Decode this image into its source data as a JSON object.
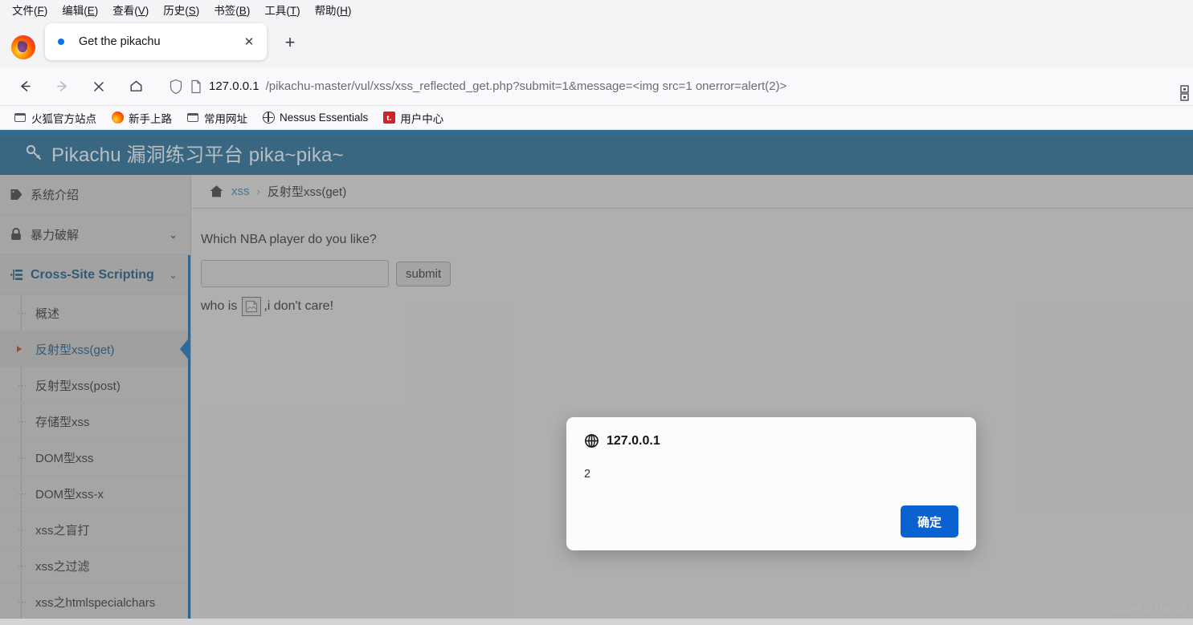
{
  "browser": {
    "menus": [
      {
        "label": "文件",
        "accel": "F"
      },
      {
        "label": "编辑",
        "accel": "E"
      },
      {
        "label": "查看",
        "accel": "V"
      },
      {
        "label": "历史",
        "accel": "S"
      },
      {
        "label": "书签",
        "accel": "B"
      },
      {
        "label": "工具",
        "accel": "T"
      },
      {
        "label": "帮助",
        "accel": "H"
      }
    ],
    "tab": {
      "title": "Get the pikachu",
      "close_label": "✕",
      "newtab_label": "+"
    },
    "nav": {
      "back": "←",
      "forward": "→",
      "stop": "✕",
      "home": "⌂"
    },
    "url": {
      "host": "127.0.0.1",
      "path": "/pikachu-master/vul/xss/xss_reflected_get.php?submit=1&message=<img src=1 onerror=alert(2)>"
    },
    "bookmarks": [
      {
        "label": "火狐官方站点",
        "icon": "folder-icon"
      },
      {
        "label": "新手上路",
        "icon": "firefox-icon"
      },
      {
        "label": "常用网址",
        "icon": "folder-icon"
      },
      {
        "label": "Nessus Essentials",
        "icon": "globe-icon"
      },
      {
        "label": "用户中心",
        "icon": "tencent-icon"
      }
    ]
  },
  "site": {
    "brand": "Pikachu 漏洞练习平台 pika~pika~",
    "sidebar": [
      {
        "label": "系统介绍",
        "icon": "tag-icon",
        "type": "link"
      },
      {
        "label": "暴力破解",
        "icon": "lock-icon",
        "type": "section",
        "chevron": "⌄"
      },
      {
        "label": "Cross-Site Scripting",
        "icon": "xss-icon",
        "type": "section",
        "chevron": "⌄",
        "active": true
      }
    ],
    "submenu": [
      {
        "label": "概述"
      },
      {
        "label": "反射型xss(get)",
        "current": true
      },
      {
        "label": "反射型xss(post)"
      },
      {
        "label": "存储型xss"
      },
      {
        "label": "DOM型xss"
      },
      {
        "label": "DOM型xss-x"
      },
      {
        "label": "xss之盲打"
      },
      {
        "label": "xss之过滤"
      },
      {
        "label": "xss之htmlspecialchars"
      }
    ],
    "breadcrumb": {
      "home_icon": "home-icon",
      "root": "xss",
      "separator": "›",
      "current": "反射型xss(get)"
    },
    "form": {
      "question": "Which NBA player do you like?",
      "input_value": "",
      "input_placeholder": "",
      "submit_label": "submit"
    },
    "answer": {
      "prefix": "who is",
      "image_alt": "broken-image",
      "suffix": ",i don't care!"
    },
    "watermark": "CSDN @Alsn86"
  },
  "dialog": {
    "icon": "globe-icon",
    "title": "127.0.0.1",
    "message": "2",
    "ok_label": "确定"
  },
  "colors": {
    "header_teal": "#336c8d",
    "accent_blue": "#2f6b9a",
    "button_blue": "#0a62d0",
    "bullet_orange": "#b4491f"
  }
}
